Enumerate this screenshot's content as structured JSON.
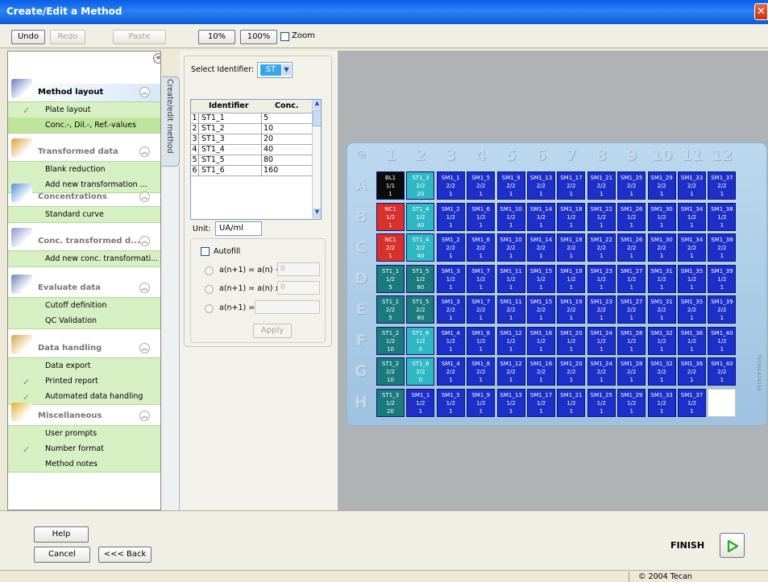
{
  "window": {
    "title": "Create/Edit a Method",
    "close_glyph": "✕"
  },
  "toolbar": {
    "undo": "Undo",
    "redo": "Redo",
    "paste": "Paste",
    "zoom10": "10%",
    "zoom100": "100%",
    "zoom_label": "Zoom"
  },
  "sidebar": {
    "collapse_glyph": "«",
    "sections": [
      {
        "title": "Method layout",
        "icon": "method-layout-icon",
        "items": [
          {
            "label": "Plate layout",
            "checked": true
          },
          {
            "label": "Conc.-, Dil.-, Ref.-values",
            "checked": false
          }
        ]
      },
      {
        "title": "Transformed data",
        "icon": "transformed-data-icon",
        "items": [
          {
            "label": "Blank reduction",
            "checked": false
          },
          {
            "label": "Add new transformation ...",
            "checked": false
          }
        ]
      },
      {
        "title": "Concentrations",
        "icon": "concentrations-icon",
        "items": [
          {
            "label": "Standard curve",
            "checked": false
          }
        ]
      },
      {
        "title": "Conc. transformed d...",
        "icon": "conc-transformed-icon",
        "items": [
          {
            "label": "Add new conc. transformati...",
            "checked": false
          }
        ]
      },
      {
        "title": "Evaluate data",
        "icon": "evaluate-data-icon",
        "items": [
          {
            "label": "Cutoff definition",
            "checked": false
          },
          {
            "label": "QC Validation",
            "checked": false
          }
        ]
      },
      {
        "title": "Data handling",
        "icon": "data-handling-icon",
        "items": [
          {
            "label": "Data export",
            "checked": false
          },
          {
            "label": "Printed report",
            "checked": true
          },
          {
            "label": "Automated data handling",
            "checked": true
          }
        ]
      },
      {
        "title": "Miscellaneous",
        "icon": "miscellaneous-icon",
        "items": [
          {
            "label": "User prompts",
            "checked": false
          },
          {
            "label": "Number format",
            "checked": true
          },
          {
            "label": "Method notes",
            "checked": false
          }
        ]
      }
    ]
  },
  "vertical_tab": {
    "label": "Create/edit method"
  },
  "middle": {
    "select_identifier_label": "Select Identifier:",
    "identifier_value": "ST",
    "table": {
      "headers": [
        "Identifier",
        "Conc."
      ],
      "rows": [
        [
          "1",
          "ST1_1",
          "5"
        ],
        [
          "2",
          "ST1_2",
          "10"
        ],
        [
          "3",
          "ST1_3",
          "20"
        ],
        [
          "4",
          "ST1_4",
          "40"
        ],
        [
          "5",
          "ST1_5",
          "80"
        ],
        [
          "6",
          "ST1_6",
          "160"
        ]
      ]
    },
    "unit_label": "Unit:",
    "unit_value": "UA/ml",
    "autofill_label": "Autofill",
    "formulas": [
      "a(n+1) = a(n) +",
      "a(n+1) = a(n) x",
      "a(n+1) ="
    ],
    "formula_values": [
      "0",
      "0",
      ""
    ],
    "apply_label": "Apply"
  },
  "plate": {
    "corner": "⊙",
    "columns": [
      "1",
      "2",
      "3",
      "4",
      "5",
      "6",
      "7",
      "8",
      "9",
      "10",
      "11",
      "12"
    ],
    "rows": [
      "A",
      "B",
      "C",
      "D",
      "E",
      "F",
      "G",
      "H"
    ],
    "brand": "TECAN A14350",
    "colors": {
      "BL": "#0b0b0b",
      "NC": "#d9302c",
      "ST": "#1a7a7e",
      "STL": "#2fb8c4",
      "SM": "#1d2fc8",
      "EMPTY": "#ffffff"
    },
    "wells": [
      [
        [
          "BL1",
          "1/1",
          "1",
          "BL"
        ],
        [
          "ST1_3",
          "2/2",
          "20",
          "STL"
        ],
        [
          "SM1_1",
          "2/2",
          "1",
          "SM"
        ],
        [
          "SM1_5",
          "2/2",
          "1",
          "SM"
        ],
        [
          "SM1_9",
          "2/2",
          "1",
          "SM"
        ],
        [
          "SM1_13",
          "2/2",
          "1",
          "SM"
        ],
        [
          "SM1_17",
          "2/2",
          "1",
          "SM"
        ],
        [
          "SM1_21",
          "2/2",
          "1",
          "SM"
        ],
        [
          "SM1_25",
          "2/2",
          "1",
          "SM"
        ],
        [
          "SM1_29",
          "2/2",
          "1",
          "SM"
        ],
        [
          "SM1_33",
          "2/2",
          "1",
          "SM"
        ],
        [
          "SM1_37",
          "2/2",
          "1",
          "SM"
        ]
      ],
      [
        [
          "NC1",
          "1/2",
          "1",
          "NC"
        ],
        [
          "ST1_4",
          "1/2",
          "40",
          "STL"
        ],
        [
          "SM1_2",
          "1/2",
          "1",
          "SM"
        ],
        [
          "SM1_6",
          "1/2",
          "1",
          "SM"
        ],
        [
          "SM1_10",
          "1/2",
          "1",
          "SM"
        ],
        [
          "SM1_14",
          "1/2",
          "1",
          "SM"
        ],
        [
          "SM1_18",
          "1/2",
          "1",
          "SM"
        ],
        [
          "SM1_22",
          "1/2",
          "1",
          "SM"
        ],
        [
          "SM1_26",
          "1/2",
          "1",
          "SM"
        ],
        [
          "SM1_30",
          "1/2",
          "1",
          "SM"
        ],
        [
          "SM1_34",
          "1/2",
          "1",
          "SM"
        ],
        [
          "SM1_38",
          "1/2",
          "1",
          "SM"
        ]
      ],
      [
        [
          "NC1",
          "2/2",
          "1",
          "NC"
        ],
        [
          "ST1_4",
          "2/2",
          "40",
          "STL"
        ],
        [
          "SM1_2",
          "2/2",
          "1",
          "SM"
        ],
        [
          "SM1_6",
          "2/2",
          "1",
          "SM"
        ],
        [
          "SM1_10",
          "2/2",
          "1",
          "SM"
        ],
        [
          "SM1_14",
          "2/2",
          "1",
          "SM"
        ],
        [
          "SM1_18",
          "2/2",
          "1",
          "SM"
        ],
        [
          "SM1_22",
          "2/2",
          "1",
          "SM"
        ],
        [
          "SM1_26",
          "2/2",
          "1",
          "SM"
        ],
        [
          "SM1_30",
          "2/2",
          "1",
          "SM"
        ],
        [
          "SM1_34",
          "2/2",
          "1",
          "SM"
        ],
        [
          "SM1_38",
          "2/2",
          "1",
          "SM"
        ]
      ],
      [
        [
          "ST1_1",
          "1/2",
          "5",
          "ST"
        ],
        [
          "ST1_5",
          "1/2",
          "80",
          "ST"
        ],
        [
          "SM1_3",
          "1/2",
          "1",
          "SM"
        ],
        [
          "SM1_7",
          "1/2",
          "1",
          "SM"
        ],
        [
          "SM1_11",
          "1/2",
          "1",
          "SM"
        ],
        [
          "SM1_15",
          "1/2",
          "1",
          "SM"
        ],
        [
          "SM1_19",
          "1/2",
          "1",
          "SM"
        ],
        [
          "SM1_23",
          "1/2",
          "1",
          "SM"
        ],
        [
          "SM1_27",
          "1/2",
          "1",
          "SM"
        ],
        [
          "SM1_31",
          "1/2",
          "1",
          "SM"
        ],
        [
          "SM1_35",
          "1/2",
          "1",
          "SM"
        ],
        [
          "SM1_39",
          "1/2",
          "1",
          "SM"
        ]
      ],
      [
        [
          "ST1_1",
          "2/2",
          "5",
          "ST"
        ],
        [
          "ST1_5",
          "2/2",
          "80",
          "ST"
        ],
        [
          "SM1_3",
          "2/2",
          "1",
          "SM"
        ],
        [
          "SM1_7",
          "2/2",
          "1",
          "SM"
        ],
        [
          "SM1_11",
          "2/2",
          "1",
          "SM"
        ],
        [
          "SM1_15",
          "2/2",
          "1",
          "SM"
        ],
        [
          "SM1_19",
          "2/2",
          "1",
          "SM"
        ],
        [
          "SM1_23",
          "2/2",
          "1",
          "SM"
        ],
        [
          "SM1_27",
          "2/2",
          "1",
          "SM"
        ],
        [
          "SM1_31",
          "2/2",
          "1",
          "SM"
        ],
        [
          "SM1_35",
          "2/2",
          "1",
          "SM"
        ],
        [
          "SM1_39",
          "2/2",
          "1",
          "SM"
        ]
      ],
      [
        [
          "ST1_2",
          "1/2",
          "10",
          "ST"
        ],
        [
          "ST1_6",
          "1/2",
          "0",
          "STL"
        ],
        [
          "SM1_4",
          "1/2",
          "1",
          "SM"
        ],
        [
          "SM1_8",
          "1/2",
          "1",
          "SM"
        ],
        [
          "SM1_12",
          "1/2",
          "1",
          "SM"
        ],
        [
          "SM1_16",
          "1/2",
          "1",
          "SM"
        ],
        [
          "SM1_20",
          "1/2",
          "1",
          "SM"
        ],
        [
          "SM1_24",
          "1/2",
          "1",
          "SM"
        ],
        [
          "SM1_28",
          "1/2",
          "1",
          "SM"
        ],
        [
          "SM1_32",
          "1/2",
          "1",
          "SM"
        ],
        [
          "SM1_36",
          "1/2",
          "1",
          "SM"
        ],
        [
          "SM1_40",
          "1/2",
          "1",
          "SM"
        ]
      ],
      [
        [
          "ST1_2",
          "2/2",
          "10",
          "ST"
        ],
        [
          "ST1_6",
          "2/2",
          "0",
          "STL"
        ],
        [
          "SM1_4",
          "2/2",
          "1",
          "SM"
        ],
        [
          "SM1_8",
          "2/2",
          "1",
          "SM"
        ],
        [
          "SM1_12",
          "2/2",
          "1",
          "SM"
        ],
        [
          "SM1_16",
          "2/2",
          "1",
          "SM"
        ],
        [
          "SM1_20",
          "2/2",
          "1",
          "SM"
        ],
        [
          "SM1_24",
          "2/2",
          "1",
          "SM"
        ],
        [
          "SM1_28",
          "2/2",
          "1",
          "SM"
        ],
        [
          "SM1_32",
          "2/2",
          "1",
          "SM"
        ],
        [
          "SM1_36",
          "2/2",
          "1",
          "SM"
        ],
        [
          "SM1_40",
          "2/2",
          "1",
          "SM"
        ]
      ],
      [
        [
          "ST1_3",
          "1/2",
          "20",
          "ST"
        ],
        [
          "SM1_1",
          "1/2",
          "1",
          "SM"
        ],
        [
          "SM1_5",
          "1/2",
          "1",
          "SM"
        ],
        [
          "SM1_9",
          "1/2",
          "1",
          "SM"
        ],
        [
          "SM1_13",
          "1/2",
          "1",
          "SM"
        ],
        [
          "SM1_17",
          "1/2",
          "1",
          "SM"
        ],
        [
          "SM1_21",
          "1/2",
          "1",
          "SM"
        ],
        [
          "SM1_25",
          "1/2",
          "1",
          "SM"
        ],
        [
          "SM1_29",
          "1/2",
          "1",
          "SM"
        ],
        [
          "SM1_33",
          "1/2",
          "1",
          "SM"
        ],
        [
          "SM1_37",
          "1/2",
          "1",
          "SM"
        ],
        [
          "",
          "",
          "",
          "EMPTY"
        ]
      ]
    ]
  },
  "footer": {
    "help": "Help",
    "cancel": "Cancel",
    "back": "<<< Back",
    "finish": "FINISH",
    "copyright": "© 2004 Tecan"
  }
}
